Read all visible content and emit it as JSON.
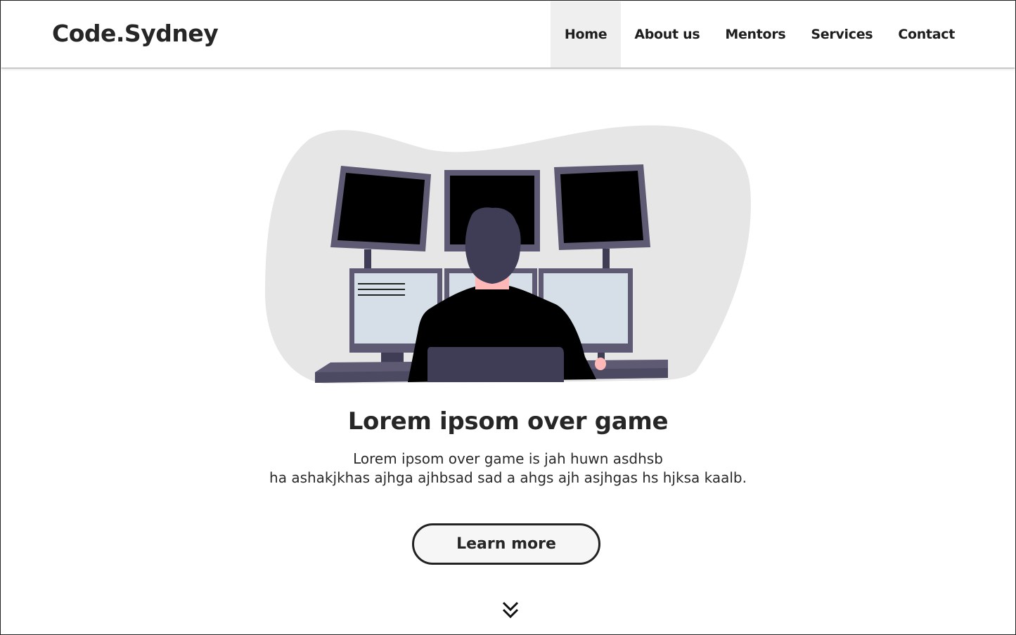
{
  "brand": {
    "name": "Code.Sydney"
  },
  "nav": {
    "items": [
      {
        "label": "Home",
        "active": true
      },
      {
        "label": "About us",
        "active": false
      },
      {
        "label": "Mentors",
        "active": false
      },
      {
        "label": "Services",
        "active": false
      },
      {
        "label": "Contact",
        "active": false
      }
    ]
  },
  "hero": {
    "illustration": "developer-at-multi-monitor-desk",
    "title": "Lorem ipsom over game",
    "subtitle_lines": [
      "Lorem ipsom over game is jah huwn asdhsb",
      "ha ashakjkhas ajhga ajhbsad sad a ahgs ajh asjhgas hs hjksa kaalb."
    ],
    "cta_label": "Learn more",
    "scroll_icon": "double-chevron-down-icon"
  },
  "colors": {
    "text": "#262626",
    "nav_active_bg": "#efefef",
    "blob": "#e6e6e6",
    "monitor_frame": "#5f5a73",
    "screen_light": "#d6dfe8",
    "person_dark": "#3f3d56"
  }
}
